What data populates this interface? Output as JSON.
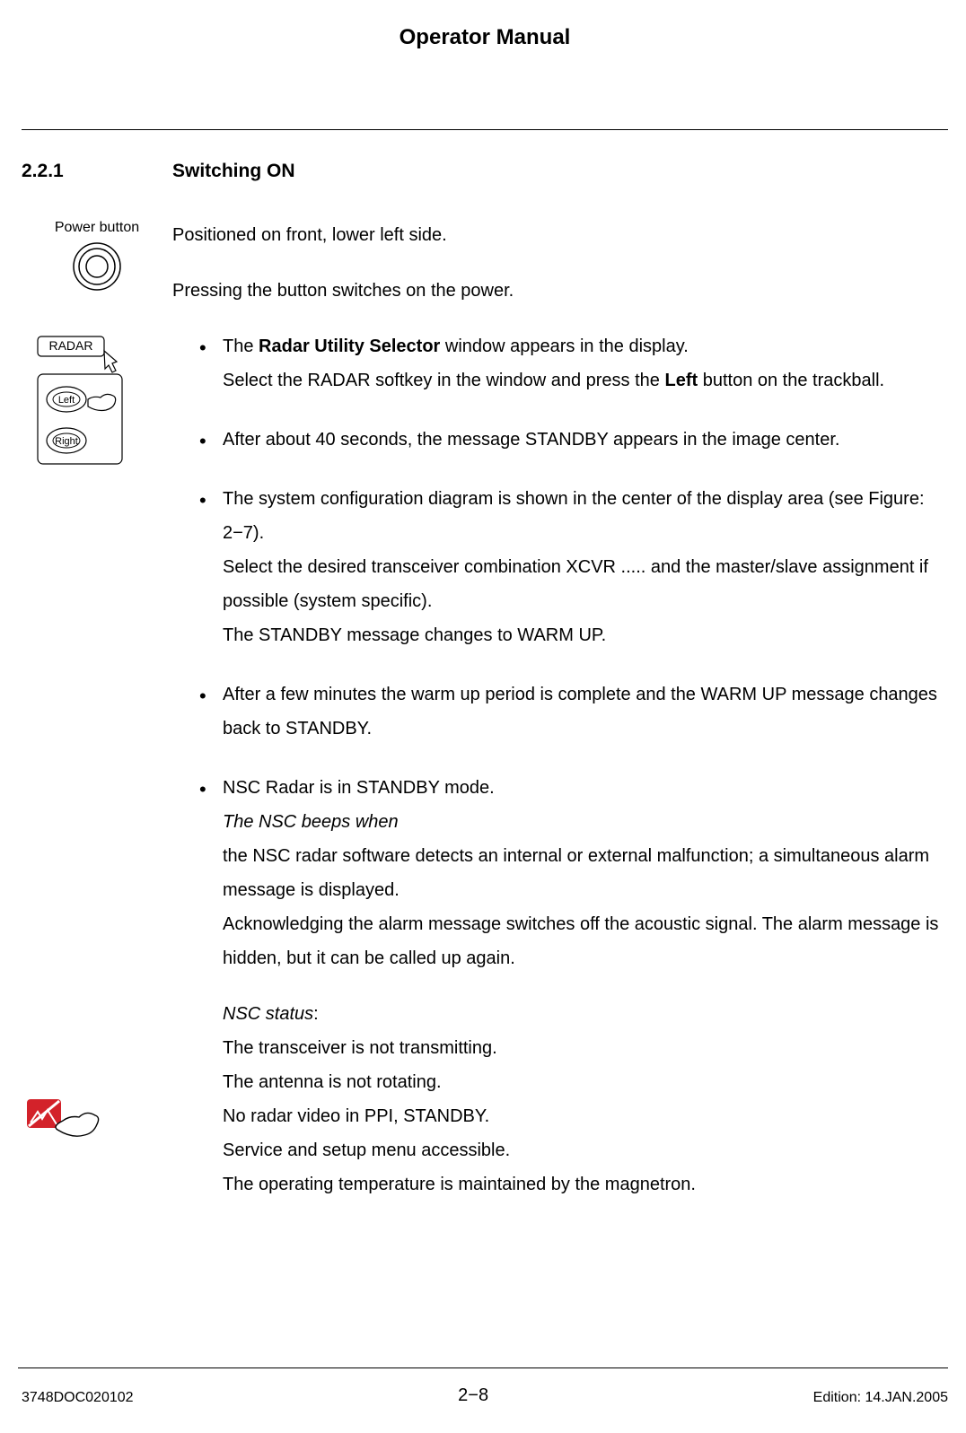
{
  "header": {
    "title": "Operator Manual"
  },
  "section": {
    "number": "2.2.1",
    "title": "Switching ON"
  },
  "margin": {
    "power_label": "Power button",
    "radar_label": "RADAR",
    "left_label": "Left",
    "right_label": "Right"
  },
  "body": {
    "p1": "Positioned on front, lower left side.",
    "p2": "Pressing the button switches on the power.",
    "b1": {
      "t1a": "The ",
      "t1b": "Radar Utility Selector",
      "t1c": " window appears in the display.",
      "t2a": "Select the RADAR softkey in the window and press the ",
      "t2b": "Left",
      "t2c": " button on the trackball."
    },
    "b2": "After about 40 seconds, the message STANDBY appears in the image center.",
    "b3": {
      "l1": "The system configuration diagram is shown in the center of the display area (see Figure: 2−7).",
      "l2": "Select the desired transceiver combination XCVR ..... and the master/slave assignment if possible (system specific).",
      "l3": "The STANDBY message changes to WARM UP."
    },
    "b4": "After a few minutes the warm up period is complete and the WARM UP message changes back to STANDBY.",
    "b5": {
      "l1": "NSC Radar is in STANDBY mode.",
      "l2": "The NSC beeps when",
      "l3": "the NSC radar software detects an internal or external malfunction; a simultaneous alarm message is displayed.",
      "l4": "Acknowledging the alarm message switches off the acoustic signal. The alarm message is hidden, but it can be called up again.",
      "status_h": "NSC status",
      "s1": "The transceiver is not transmitting.",
      "s2": "The antenna is not rotating.",
      "s3": "No radar video in PPI, STANDBY.",
      "s4": "Service and setup menu accessible.",
      "s5": "The operating temperature is maintained by the magnetron."
    }
  },
  "footer": {
    "doc": "3748DOC020102",
    "page": "2−8",
    "edition": "Edition: 14.JAN.2005"
  }
}
